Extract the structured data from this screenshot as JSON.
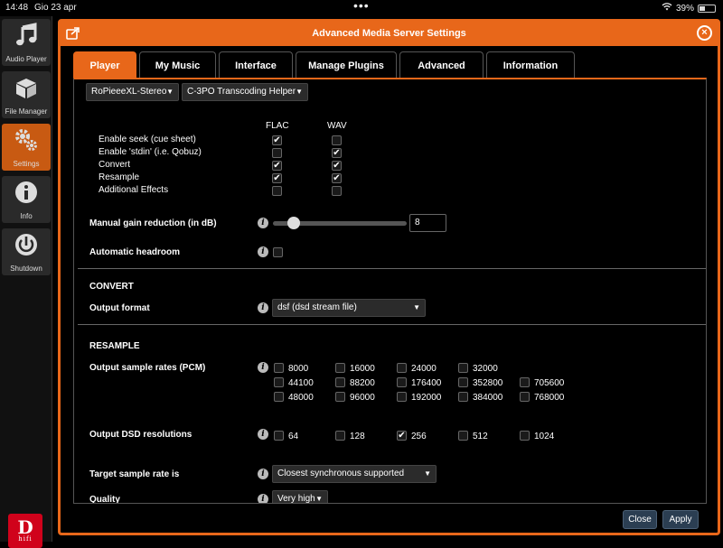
{
  "status_bar": {
    "time": "14:48",
    "date": "Gio 23 apr",
    "dots": "•••",
    "battery": "39%",
    "battery_level": 0.39
  },
  "sidebar": {
    "items": [
      {
        "label": "Audio Player",
        "icon": "music-note-icon"
      },
      {
        "label": "File Manager",
        "icon": "box-icon"
      },
      {
        "label": "Settings",
        "icon": "gears-icon"
      },
      {
        "label": "Info",
        "icon": "info-icon"
      },
      {
        "label": "Shutdown",
        "icon": "power-icon"
      }
    ],
    "logo": {
      "big": "D",
      "small": "hifi"
    }
  },
  "dialog": {
    "title": "Advanced Media Server Settings",
    "close": "×",
    "accent": "#e8671a"
  },
  "tabs": [
    "Player",
    "My Music",
    "Interface",
    "Manage Plugins",
    "Advanced",
    "Information"
  ],
  "player": {
    "device_select": "RoPieeeXL-Stereo",
    "helper_select": "C-3PO Transcoding Helper",
    "col_flac": "FLAC",
    "col_wav": "WAV",
    "options": [
      {
        "label": "Enable seek (cue sheet)",
        "flac": true,
        "wav": false
      },
      {
        "label": "Enable 'stdin' (i.e. Qobuz)",
        "flac": false,
        "wav": true
      },
      {
        "label": "Convert",
        "flac": true,
        "wav": true
      },
      {
        "label": "Resample",
        "flac": true,
        "wav": true
      },
      {
        "label": "Additional Effects",
        "flac": false,
        "wav": false
      }
    ],
    "gain_label": "Manual gain reduction (in dB)",
    "gain_value": "8",
    "gain_slider_fraction": 0.12,
    "headroom_label": "Automatic headroom",
    "headroom_checked": false
  },
  "convert": {
    "heading": "CONVERT",
    "output_format_label": "Output format",
    "output_format_value": "dsf (dsd stream file)"
  },
  "resample": {
    "heading": "RESAMPLE",
    "pcm_label": "Output sample rates (PCM)",
    "pcm_rates": [
      {
        "value": "8000",
        "checked": false
      },
      {
        "value": "16000",
        "checked": false
      },
      {
        "value": "24000",
        "checked": false
      },
      {
        "value": "32000",
        "checked": false
      },
      {
        "value": "44100",
        "checked": false
      },
      {
        "value": "88200",
        "checked": false
      },
      {
        "value": "176400",
        "checked": false
      },
      {
        "value": "352800",
        "checked": false
      },
      {
        "value": "705600",
        "checked": false
      },
      {
        "value": "48000",
        "checked": false
      },
      {
        "value": "96000",
        "checked": false
      },
      {
        "value": "192000",
        "checked": false
      },
      {
        "value": "384000",
        "checked": false
      },
      {
        "value": "768000",
        "checked": false
      }
    ],
    "dsd_label": "Output DSD resolutions",
    "dsd_rates": [
      {
        "value": "64",
        "checked": false
      },
      {
        "value": "128",
        "checked": false
      },
      {
        "value": "256",
        "checked": true
      },
      {
        "value": "512",
        "checked": false
      },
      {
        "value": "1024",
        "checked": false
      }
    ],
    "target_label": "Target sample rate is",
    "target_value": "Closest synchronous supported",
    "quality_label": "Quality",
    "quality_value": "Very high"
  },
  "footer": {
    "close": "Close",
    "apply": "Apply"
  }
}
